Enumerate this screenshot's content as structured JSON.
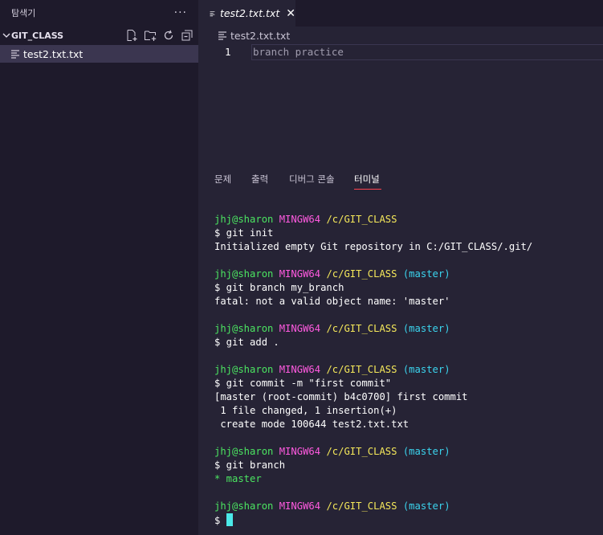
{
  "sidebar": {
    "title": "탐색기",
    "more": "···",
    "folder": "GIT_CLASS",
    "files": [
      {
        "name": "test2.txt.txt"
      }
    ]
  },
  "editor": {
    "tab_title": "test2.txt.txt",
    "tab_close": "✕",
    "breadcrumb": "test2.txt.txt",
    "lines": [
      {
        "no": "1",
        "text": "branch practice"
      }
    ]
  },
  "panel": {
    "tabs": [
      "문제",
      "출력",
      "디버그 콘솔",
      "터미널"
    ],
    "active_tab": "터미널"
  },
  "terminal": {
    "user": "jhj@sharon",
    "host": "MINGW64",
    "path": "/c/GIT_CLASS",
    "blocks": [
      {
        "prompt_branch": "",
        "cmd": "$ git init",
        "output": [
          "Initialized empty Git repository in C:/GIT_CLASS/.git/"
        ]
      },
      {
        "prompt_branch": "(master)",
        "cmd": "$ git branch my_branch",
        "output": [
          "fatal: not a valid object name: 'master'"
        ]
      },
      {
        "prompt_branch": "(master)",
        "cmd": "$ git add .",
        "output": []
      },
      {
        "prompt_branch": "(master)",
        "cmd": "$ git commit -m \"first commit\"",
        "output": [
          "[master (root-commit) b4c0700] first commit",
          " 1 file changed, 1 insertion(+)",
          " create mode 100644 test2.txt.txt"
        ]
      },
      {
        "prompt_branch": "(master)",
        "cmd": "$ git branch",
        "output": [
          "* master"
        ]
      },
      {
        "prompt_branch": "(master)",
        "cmd": "$ ",
        "output": []
      }
    ]
  },
  "colors": {
    "user": "#4be561",
    "host": "#ff5ae0",
    "path": "#f5e85a",
    "branch": "#3bd4ee",
    "background": "#262335",
    "sidebar": "#1e1a2b",
    "active_underline": "#fe4450"
  },
  "icons": [
    "new-file-icon",
    "new-folder-icon",
    "refresh-icon",
    "collapse-all-icon",
    "file-lines-icon",
    "chevron-down-icon",
    "close-icon"
  ]
}
